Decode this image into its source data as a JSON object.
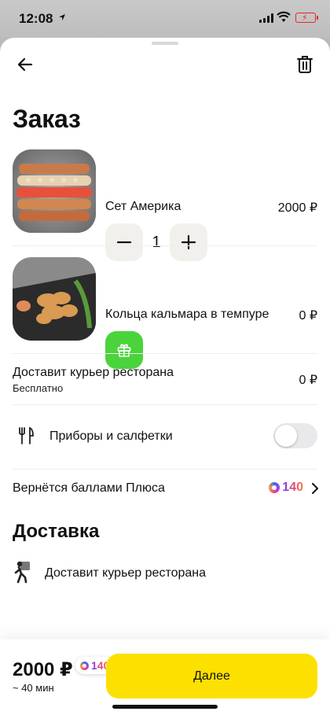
{
  "status_bar": {
    "time": "12:08"
  },
  "header": {
    "title": "Заказ"
  },
  "items": [
    {
      "name": "Сет Америка",
      "price": "2000 ₽",
      "quantity": "1"
    },
    {
      "name": "Кольца кальмара в темпуре",
      "price": "0 ₽"
    }
  ],
  "delivery_row": {
    "title": "Доставит курьер ресторана",
    "subtitle": "Бесплатно",
    "price": "0 ₽"
  },
  "cutlery_row": {
    "label": "Приборы и салфетки",
    "enabled": false
  },
  "plus_row": {
    "label": "Вернётся баллами Плюса",
    "points": "140"
  },
  "delivery_section": {
    "title": "Доставка",
    "method": "Доставит курьер ресторана"
  },
  "footer": {
    "total": "2000 ₽",
    "eta": "~ 40 мин",
    "bonus": "140",
    "next_label": "Далее"
  },
  "colors": {
    "accent": "#fce000",
    "gift": "#4bd33c"
  }
}
